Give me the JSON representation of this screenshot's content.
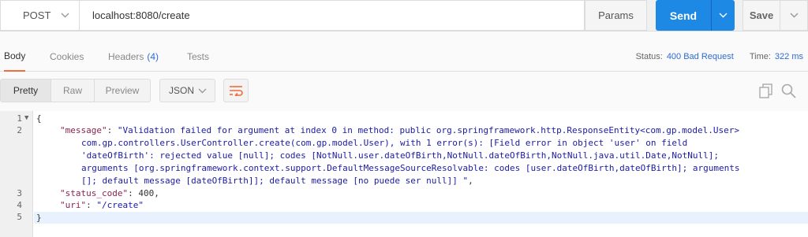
{
  "request": {
    "method": "POST",
    "url": "localhost:8080/create",
    "params_label": "Params",
    "send_label": "Send",
    "save_label": "Save"
  },
  "response_tabs": {
    "body": "Body",
    "cookies": "Cookies",
    "headers": "Headers",
    "headers_count": "(4)",
    "tests": "Tests"
  },
  "status": {
    "status_label": "Status:",
    "status_value": "400 Bad Request",
    "time_label": "Time:",
    "time_value": "322 ms"
  },
  "view": {
    "pretty": "Pretty",
    "raw": "Raw",
    "preview": "Preview",
    "format": "JSON"
  },
  "code": {
    "line_numbers": [
      "1",
      "2",
      "3",
      "4",
      "5"
    ],
    "l1_brace": "{",
    "l2_key": "\"message\"",
    "l2_sep": ": ",
    "l2_val_a": "\"Validation failed for argument at index 0 in method: public org.springframework.http.ResponseEntity<com.gp.model.User>",
    "l2_val_b": "com.gp.controllers.UserController.create(com.gp.model.User), with 1 error(s): [Field error in object 'user' on field",
    "l2_val_c": "'dateOfBirth': rejected value [null]; codes [NotNull.user.dateOfBirth,NotNull.dateOfBirth,NotNull.java.util.Date,NotNull];",
    "l2_val_d": "arguments [org.springframework.context.support.DefaultMessageSourceResolvable: codes [user.dateOfBirth,dateOfBirth]; arguments",
    "l2_val_e": "[]; default message [dateOfBirth]]; default message [no puede ser null]] \"",
    "l2_end": ",",
    "l3_key": "\"status_code\"",
    "l3_sep": ": ",
    "l3_val": "400",
    "l3_end": ",",
    "l4_key": "\"uri\"",
    "l4_sep": ": ",
    "l4_val": "\"/create\"",
    "l5_brace": "}"
  },
  "colors": {
    "accent": "#1e88e5",
    "active_tab": "#f26b3a",
    "status_blue": "#2f6bd5"
  },
  "icons": [
    "chevron-down-icon",
    "wrap-lines-icon",
    "copy-icon",
    "search-icon",
    "fold-arrow-icon"
  ]
}
